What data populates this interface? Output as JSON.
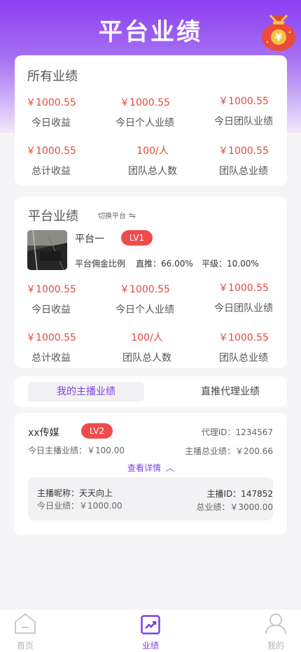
{
  "header": {
    "title": "平台业绩"
  },
  "all_perf": {
    "title": "所有业绩",
    "stats": [
      {
        "value": "￥1000.55",
        "label": "今日收益"
      },
      {
        "value": "￥1000.55",
        "label": "今日个人业绩"
      },
      {
        "value": "￥1000.55",
        "label": "今日团队业绩"
      },
      {
        "value": "￥1000.55",
        "label": "总计收益"
      },
      {
        "value": "100/人",
        "label": "团队总人数"
      },
      {
        "value": "￥1000.55",
        "label": "团队总业绩"
      }
    ]
  },
  "platform": {
    "title": "平台业绩",
    "switch_label": "切换平台",
    "name": "平台一",
    "level": "LV1",
    "commission_label": "平台佣金比例",
    "direct": "直推：66.00%",
    "peer": "平级：10.00%",
    "stats": [
      {
        "value": "￥1000.55",
        "label": "今日收益"
      },
      {
        "value": "￥1000.55",
        "label": "今日个人业绩"
      },
      {
        "value": "￥1000.55",
        "label": "今日团队业绩"
      },
      {
        "value": "￥1000.55",
        "label": "总计收益"
      },
      {
        "value": "100/人",
        "label": "团队总人数"
      },
      {
        "value": "￥1000.55",
        "label": "团队总业绩"
      }
    ]
  },
  "tabs": {
    "active": "我的主播业绩",
    "inactive": "直推代理业绩"
  },
  "agent": {
    "name": "xx传媒",
    "level": "LV2",
    "agent_id": "代理ID：1234567",
    "today_anchor": "今日主播业绩：￥100.00",
    "total_anchor": "主播总业绩：￥200.66",
    "detail_link": "查看详情",
    "anchor_nick": "主播昵称：天天向上",
    "anchor_id": "主播ID：147852",
    "anchor_today": "今日业绩：￥1000.00",
    "anchor_total": "总业绩：￥3000.00"
  },
  "nav": {
    "home": "首页",
    "perf": "业绩",
    "mine": "我的"
  },
  "colors": {
    "accent": "#8a3ff2",
    "value_red": "#e4483f",
    "badge": "#ef4b4b"
  }
}
